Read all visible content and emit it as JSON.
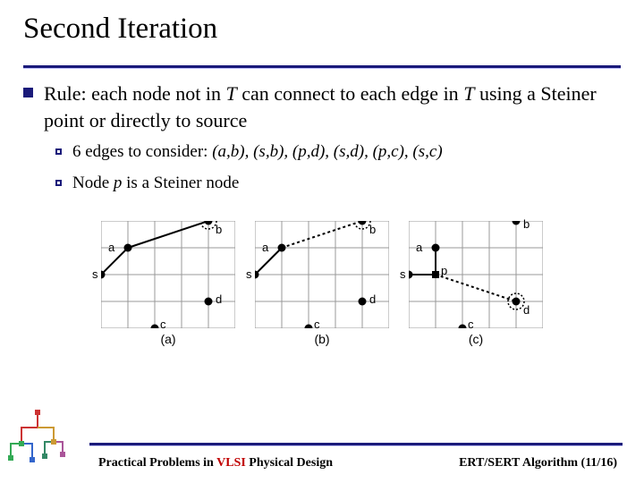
{
  "title": "Second Iteration",
  "rule": {
    "prefix": "Rule: each node not in ",
    "T1": "T",
    "mid": " can connect to each edge in ",
    "T2": "T",
    "suffix": " using a Steiner point or directly to source"
  },
  "sub1": {
    "prefix": "6 edges to consider: ",
    "edges": "(a,b), (s,b), (p,d), (s,d), (p,c), (s,c)"
  },
  "sub2": {
    "prefix": "Node ",
    "p": "p",
    "suffix": " is a Steiner node"
  },
  "labels": {
    "a": "a",
    "b": "b",
    "c": "c",
    "d": "d",
    "s": "s",
    "p": "p"
  },
  "captions": {
    "a": "(a)",
    "b": "(b)",
    "c": "(c)"
  },
  "footer": {
    "left_pre": "Practical Problems in ",
    "vlsi": "VLSI",
    "left_post": " Physical Design",
    "right": "ERT/SERT Algorithm (11/16)"
  }
}
